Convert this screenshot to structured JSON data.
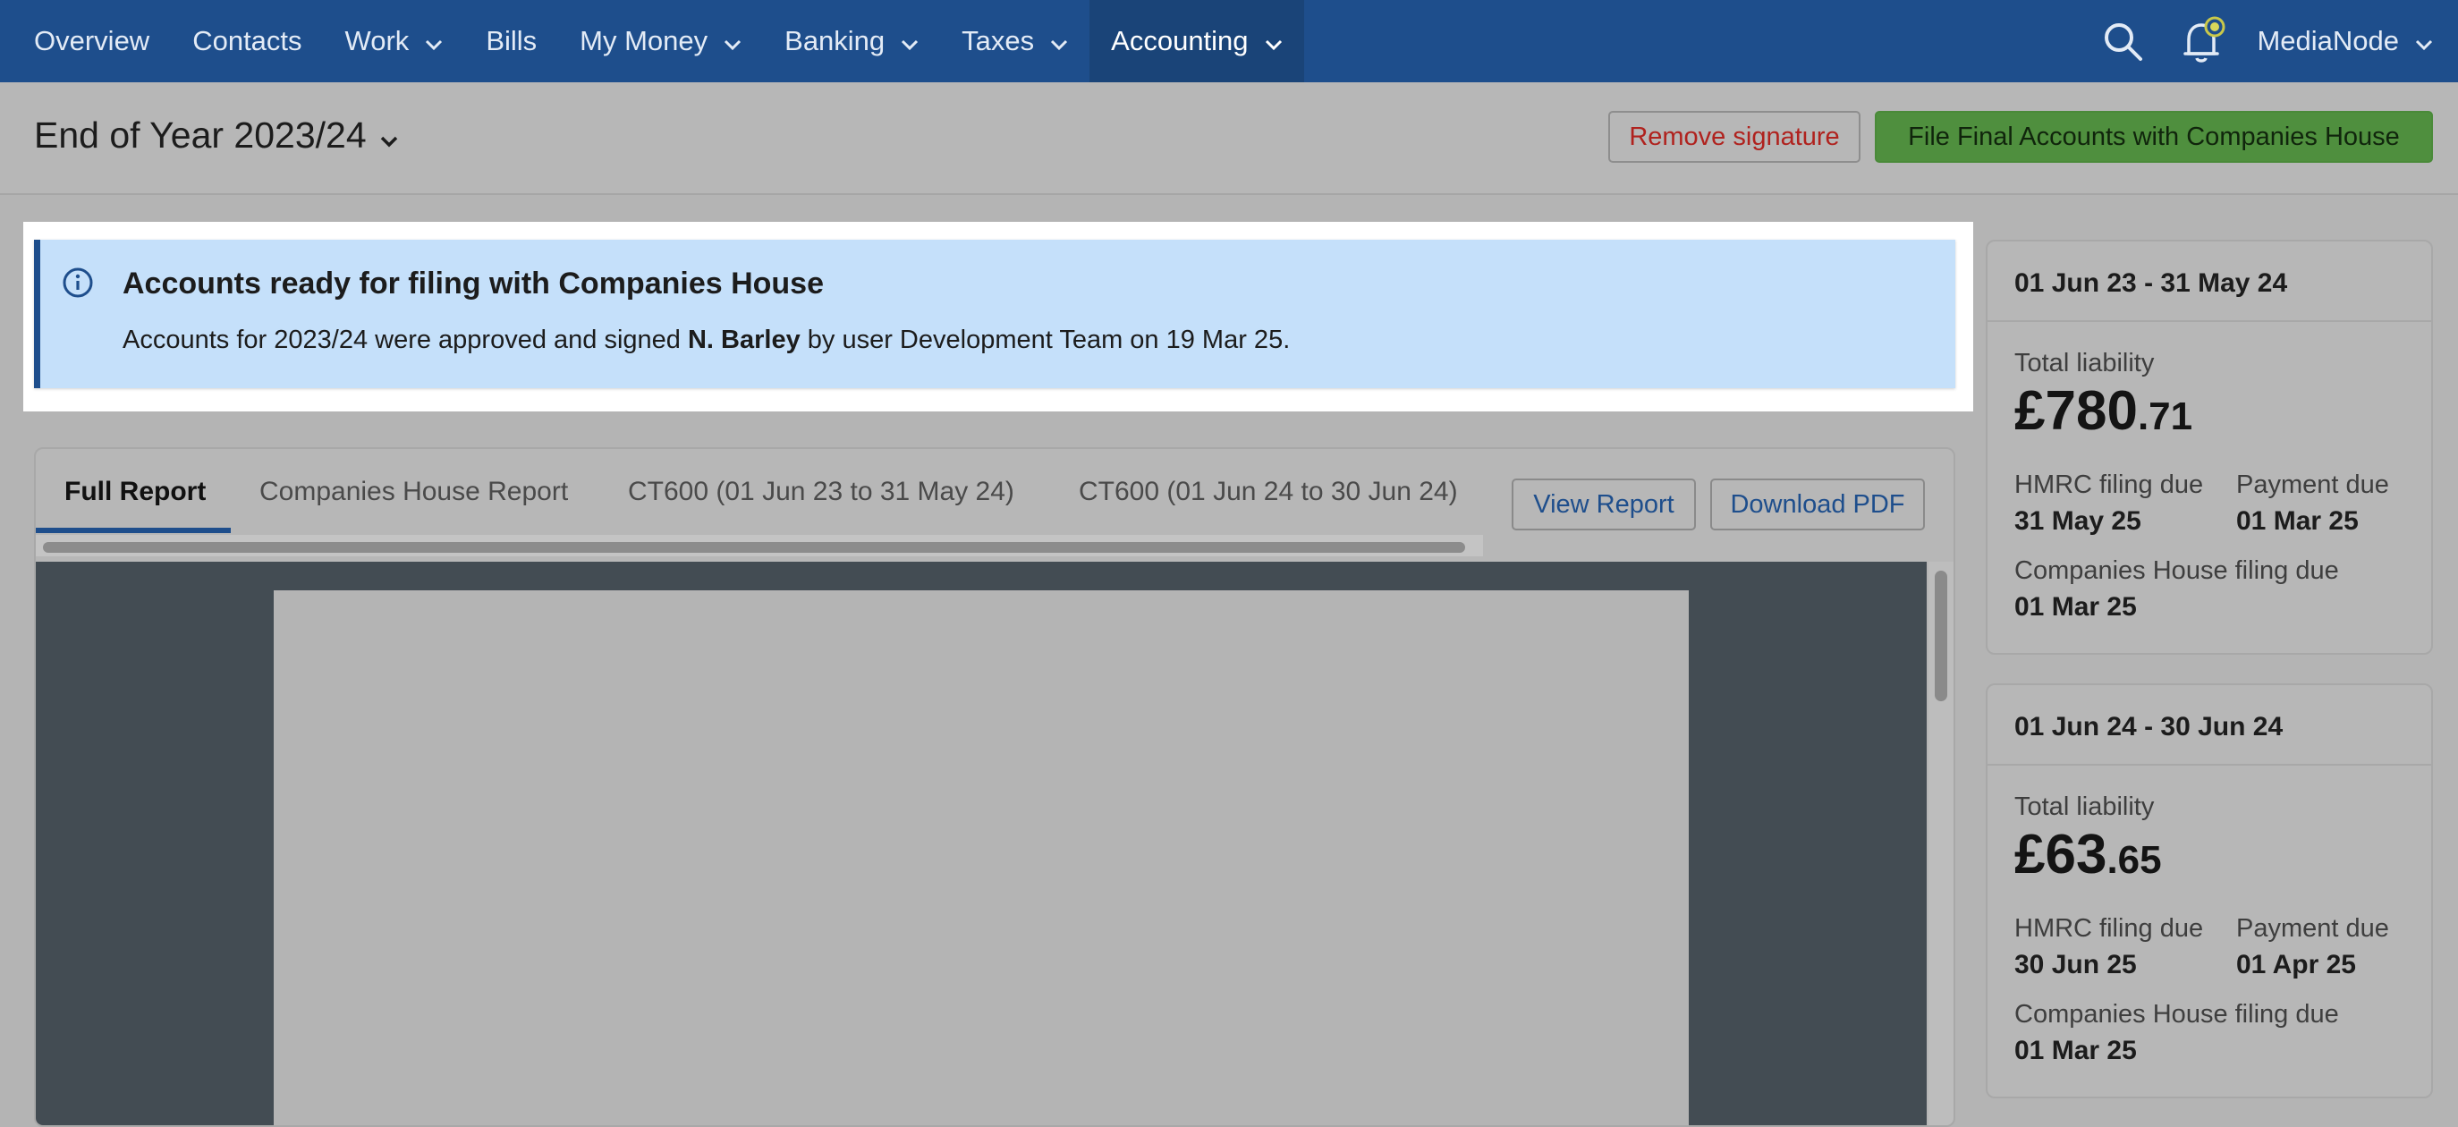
{
  "nav": {
    "items": [
      {
        "label": "Overview",
        "dropdown": false
      },
      {
        "label": "Contacts",
        "dropdown": false
      },
      {
        "label": "Work",
        "dropdown": true
      },
      {
        "label": "Bills",
        "dropdown": false
      },
      {
        "label": "My Money",
        "dropdown": true
      },
      {
        "label": "Banking",
        "dropdown": true
      },
      {
        "label": "Taxes",
        "dropdown": true
      },
      {
        "label": "Accounting",
        "dropdown": true,
        "active": true
      }
    ],
    "user": "MediaNode",
    "icons": [
      "search-icon",
      "bell-icon",
      "chevron-down-icon"
    ]
  },
  "header": {
    "title": "End of Year 2023/24",
    "remove_signature": "Remove signature",
    "file_accounts": "File Final Accounts with Companies House"
  },
  "banner": {
    "title": "Accounts ready for filing with Companies House",
    "text_before": "Accounts for 2023/24 were approved and signed ",
    "signer": "N. Barley",
    "text_after": " by user Development Team on 19 Mar 25."
  },
  "report": {
    "tabs": [
      {
        "label": "Full Report",
        "active": true
      },
      {
        "label": "Companies House Report"
      },
      {
        "label": "CT600 (01 Jun 23 to 31 May 24)"
      },
      {
        "label": "CT600 (01 Jun 24 to 30 Jun 24)"
      }
    ],
    "view_report": "View Report",
    "download_pdf": "Download PDF"
  },
  "periods": [
    {
      "range": "01 Jun 23 - 31 May 24",
      "total_label": "Total liability",
      "amount_main": "£780",
      "amount_pence": ".71",
      "hmrc_label": "HMRC filing due",
      "hmrc_value": "31 May 25",
      "payment_label": "Payment due",
      "payment_value": "01 Mar 25",
      "ch_label": "Companies House filing due",
      "ch_value": "01 Mar 25"
    },
    {
      "range": "01 Jun 24 - 30 Jun 24",
      "total_label": "Total liability",
      "amount_main": "£63",
      "amount_pence": ".65",
      "hmrc_label": "HMRC filing due",
      "hmrc_value": "30 Jun 25",
      "payment_label": "Payment due",
      "payment_value": "01 Apr 25",
      "ch_label": "Companies House filing due",
      "ch_value": "01 Mar 25"
    }
  ],
  "colors": {
    "nav_bg": "#1e4e8c",
    "banner_bg": "#c5e0fa",
    "primary_button": "#4f8f3e",
    "danger_text": "#b0221e",
    "link_blue": "#1e4e8c"
  }
}
